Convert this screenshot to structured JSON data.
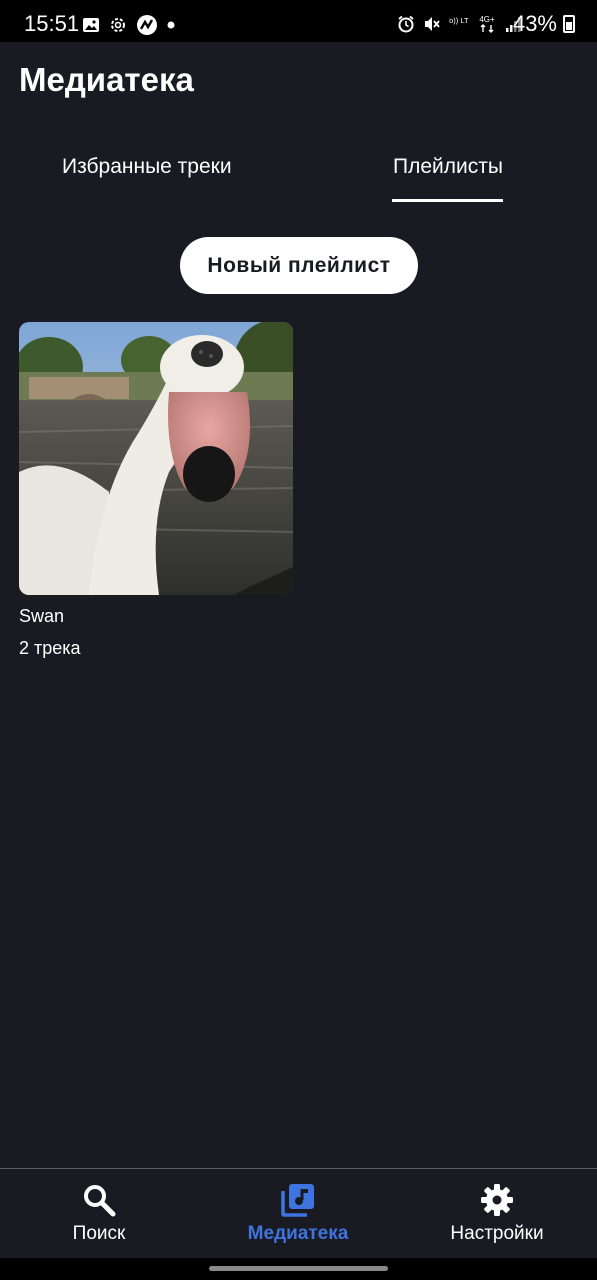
{
  "status_bar": {
    "time": "15:51",
    "battery": "43%",
    "left_icons": [
      "gallery-icon",
      "settings-gear-icon",
      "app-icon",
      "dot-icon"
    ],
    "right_icons": [
      "alarm-icon",
      "mute-icon",
      "volte-icon",
      "4g-icon",
      "signal-icon"
    ],
    "volte_label": "Vo)) LTE",
    "network_label": "4G+"
  },
  "header": {
    "title": "Медиатека"
  },
  "tabs": [
    {
      "label": "Избранные треки",
      "active": false
    },
    {
      "label": "Плейлисты",
      "active": true
    }
  ],
  "new_playlist_button": {
    "label": "Новый плейлист"
  },
  "playlists": [
    {
      "name": "Swan",
      "count": "2 трека"
    }
  ],
  "bottom_nav": {
    "items": [
      {
        "label": "Поиск",
        "icon": "search-icon",
        "active": false
      },
      {
        "label": "Медиатека",
        "icon": "library-icon",
        "active": true
      },
      {
        "label": "Настройки",
        "icon": "gear-icon",
        "active": false
      }
    ],
    "active_color": "#3d74e0"
  },
  "colors": {
    "background": "#1a1b22",
    "accent": "#3d74e0",
    "text": "#ffffff"
  }
}
